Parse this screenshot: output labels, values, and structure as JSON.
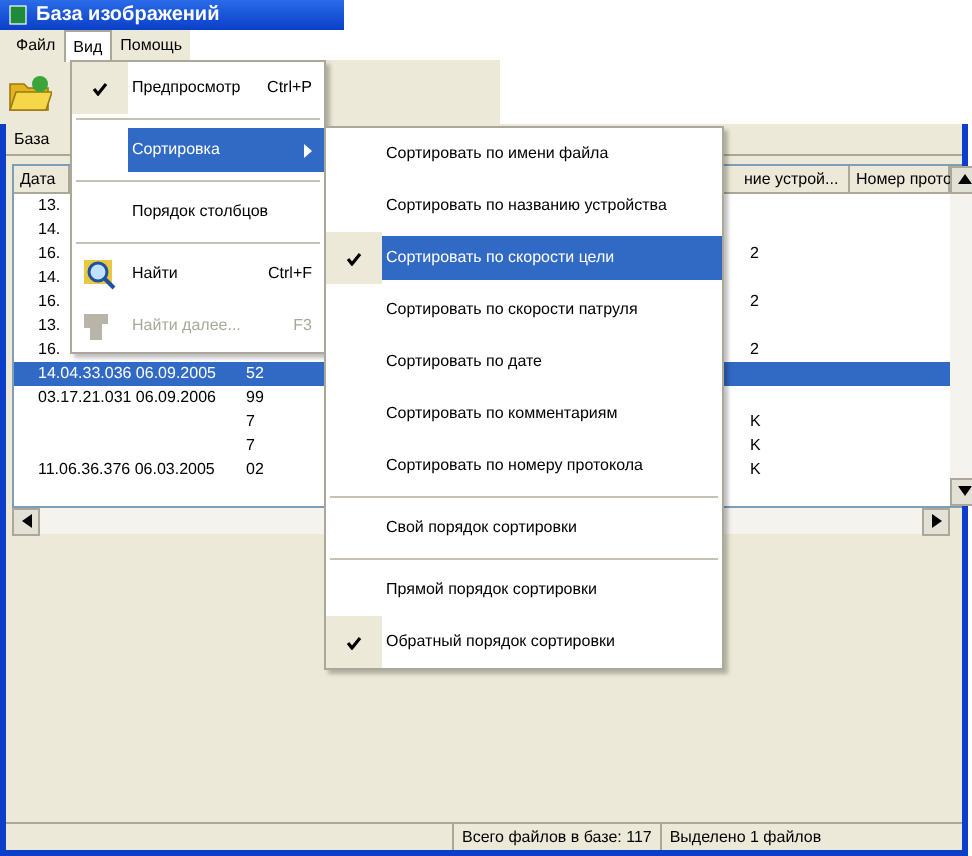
{
  "window": {
    "title": "База изображений"
  },
  "menubar": [
    {
      "label": "Файл",
      "selected": false
    },
    {
      "label": "Вид",
      "selected": true
    },
    {
      "label": "Помощь",
      "selected": false
    }
  ],
  "tab": {
    "label": "База"
  },
  "table": {
    "columns": [
      {
        "label": "Дата"
      },
      {
        "label": "ние устрой..."
      },
      {
        "label": "Номер прото"
      }
    ],
    "rows": [
      {
        "c1": "13.",
        "selected": false
      },
      {
        "c1": "14.",
        "selected": false
      },
      {
        "c1": "16.",
        "c3": "2",
        "selected": false
      },
      {
        "c1": "14.",
        "selected": false
      },
      {
        "c1": "16.",
        "c3": "2",
        "selected": false
      },
      {
        "c1": "13.",
        "selected": false
      },
      {
        "c1": "16.",
        "c3": "2",
        "selected": false
      },
      {
        "c1": "14.04.33.036 06.09.2005",
        "c2": "52",
        "selected": true
      },
      {
        "c1": "03.17.21.031 06.09.2006",
        "c2": "99",
        "selected": false
      },
      {
        "c2": "7",
        "c3": "K",
        "selected": false
      },
      {
        "c2": "7",
        "c3": "K",
        "selected": false
      },
      {
        "c1": "11.06.36.376 06.03.2005",
        "c2": "02",
        "c3": "K",
        "selected": false
      }
    ]
  },
  "view_menu": [
    {
      "kind": "item",
      "label": "Предпросмотр",
      "shortcut": "Ctrl+P",
      "checked": true,
      "selected": false,
      "disabled": false
    },
    {
      "kind": "separator"
    },
    {
      "kind": "submenu",
      "label": "Сортировка",
      "checked": false,
      "selected": true,
      "disabled": false
    },
    {
      "kind": "separator"
    },
    {
      "kind": "item",
      "label": "Порядок столбцов",
      "checked": false,
      "selected": false,
      "disabled": false
    },
    {
      "kind": "separator"
    },
    {
      "kind": "item",
      "label": "Найти",
      "shortcut": "Ctrl+F",
      "checked": false,
      "selected": false,
      "disabled": false
    },
    {
      "kind": "item",
      "label": "Найти далее...",
      "shortcut": "F3",
      "checked": false,
      "selected": false,
      "disabled": true
    }
  ],
  "sort_menu": [
    {
      "kind": "item",
      "label": "Сортировать по имени файла",
      "checked": false,
      "selected": false
    },
    {
      "kind": "item",
      "label": "Сортировать по названию устройства",
      "checked": false,
      "selected": false
    },
    {
      "kind": "item",
      "label": "Сортировать по скорости цели",
      "checked": true,
      "selected": true
    },
    {
      "kind": "item",
      "label": "Сортировать по скорости патруля",
      "checked": false,
      "selected": false
    },
    {
      "kind": "item",
      "label": "Сортировать по дате",
      "checked": false,
      "selected": false
    },
    {
      "kind": "item",
      "label": "Сортировать по комментариям",
      "checked": false,
      "selected": false
    },
    {
      "kind": "item",
      "label": "Сортировать по номеру протокола",
      "checked": false,
      "selected": false
    },
    {
      "kind": "separator"
    },
    {
      "kind": "item",
      "label": "Свой порядок сортировки",
      "checked": false,
      "selected": false
    },
    {
      "kind": "separator"
    },
    {
      "kind": "item",
      "label": "Прямой порядок сортировки",
      "checked": false,
      "selected": false
    },
    {
      "kind": "item",
      "label": "Обратный порядок сортировки",
      "checked": true,
      "selected": false
    }
  ],
  "status_bar": [
    "Всего файлов в базе: 117",
    "Выделено 1 файлов"
  ]
}
